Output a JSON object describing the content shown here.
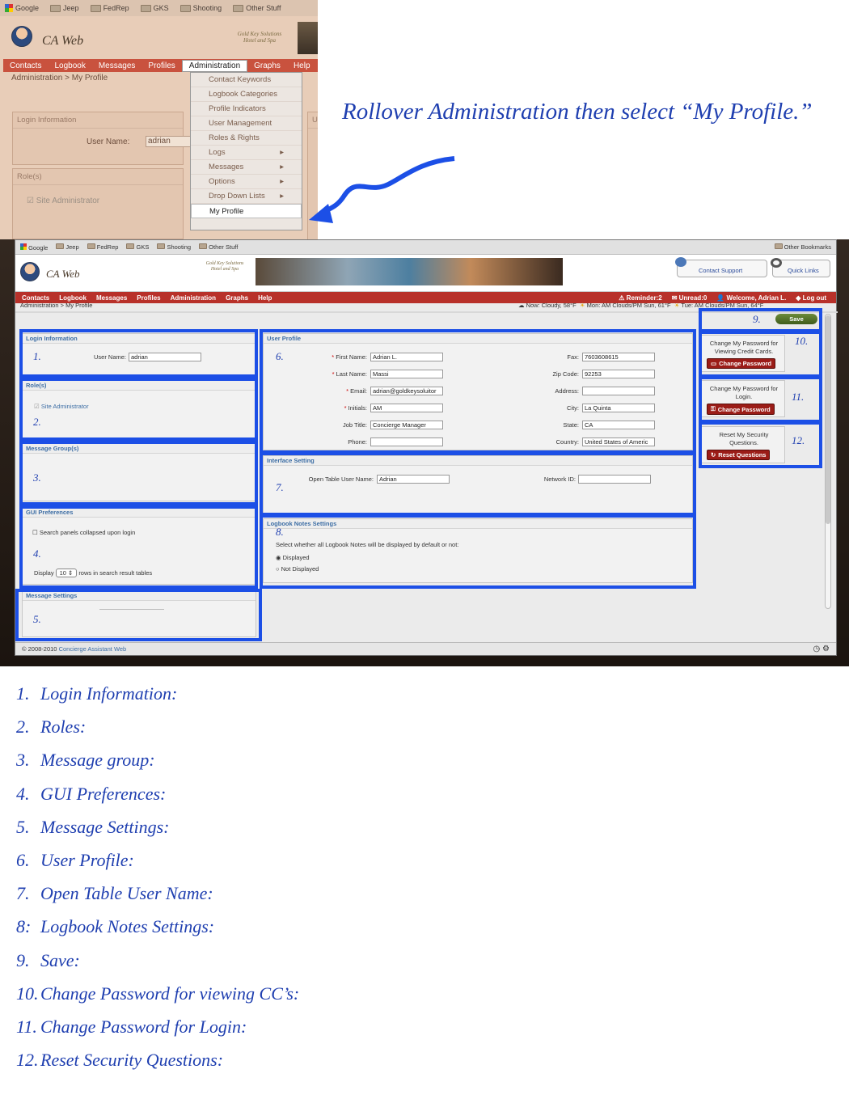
{
  "crop": {
    "bookmarks": [
      "Google",
      "Jeep",
      "FedRep",
      "GKS",
      "Shooting",
      "Other Stuff"
    ],
    "app_name": "CA Web",
    "hotel_logo": "Gold Key Solutions Hotel and Spa",
    "nav": [
      "Contacts",
      "Logbook",
      "Messages",
      "Profiles",
      "Administration",
      "Graphs",
      "Help"
    ],
    "breadcrumb": "Administration > My Profile",
    "menu": [
      "Contact Keywords",
      "Logbook Categories",
      "Profile Indicators",
      "User Management",
      "Roles & Rights",
      "Logs",
      "Messages",
      "Options",
      "Drop Down Lists",
      "My Profile"
    ],
    "menu_sub_arrows": [
      false,
      false,
      false,
      false,
      false,
      true,
      true,
      true,
      true,
      false
    ],
    "login_panel_title": "Login Information",
    "user_name_label": "User Name:",
    "user_name_value": "adrian",
    "roles_panel_title": "Role(s)",
    "role_value": "Site Administrator",
    "u_fragment": "U"
  },
  "instruction": "Rollover Administration then select “My Profile.”",
  "shot": {
    "bookmarks": [
      "Google",
      "Jeep",
      "FedRep",
      "GKS",
      "Shooting",
      "Other Stuff"
    ],
    "other_bookmarks": "Other Bookmarks",
    "app_name": "CA Web",
    "hotel_logo": "Gold Key Solutions Hotel and Spa",
    "contact_support": "Contact Support",
    "quick_links": "Quick Links",
    "nav": [
      "Contacts",
      "Logbook",
      "Messages",
      "Profiles",
      "Administration",
      "Graphs",
      "Help"
    ],
    "reminder": "Reminder:2",
    "unread": "Unread:0",
    "welcome": "Welcome, Adrian L.",
    "logout": "Log out",
    "breadcrumb": "Administration > My Profile",
    "weather_now": "Now: Cloudy, 58°F",
    "weather_mon": "Mon: AM Clouds/PM Sun, 61°F",
    "weather_tue": "Tue: AM Clouds/PM Sun, 64°F",
    "save": "Save",
    "login_info": {
      "title": "Login Information",
      "user_label": "User Name:",
      "user_value": "adrian"
    },
    "roles": {
      "title": "Role(s)",
      "value": "Site Administrator"
    },
    "message_groups": {
      "title": "Message Group(s)"
    },
    "gui_prefs": {
      "title": "GUI Preferences",
      "collapse_label": "Search panels collapsed upon login",
      "display_label": "Display",
      "rows_value": "10",
      "rows_suffix": "rows in search result tables"
    },
    "message_settings": {
      "title": "Message Settings"
    },
    "user_profile": {
      "title": "User Profile",
      "left": [
        {
          "label": "First Name:",
          "value": "Adrian L.",
          "req": true
        },
        {
          "label": "Last Name:",
          "value": "Massi",
          "req": true
        },
        {
          "label": "Email:",
          "value": "adrian@goldkeysoluitor",
          "req": true
        },
        {
          "label": "Initials:",
          "value": "AM",
          "req": true
        },
        {
          "label": "Job Title:",
          "value": "Concierge Manager",
          "req": false
        },
        {
          "label": "Phone:",
          "value": "",
          "req": false
        }
      ],
      "right": [
        {
          "label": "Fax:",
          "value": "7603608615"
        },
        {
          "label": "Zip Code:",
          "value": "92253"
        },
        {
          "label": "Address:",
          "value": ""
        },
        {
          "label": "City:",
          "value": "La Quinta"
        },
        {
          "label": "State:",
          "value": "CA"
        },
        {
          "label": "Country:",
          "value": "United States of Americ"
        }
      ]
    },
    "interface": {
      "title": "Interface Setting",
      "open_table_label": "Open Table User Name:",
      "open_table_value": "Adrian",
      "network_label": "Network ID:",
      "network_value": ""
    },
    "logbook_notes": {
      "title": "Logbook Notes Settings",
      "desc": "Select whether all Logbook Notes will be displayed by default or not:",
      "opt1": "Displayed",
      "opt2": "Not Displayed"
    },
    "cc_password": {
      "text": "Change My Password for Viewing Credit Cards.",
      "button": "Change Password"
    },
    "login_password": {
      "text": "Change My Password for Login.",
      "button": "Change Password"
    },
    "security": {
      "text": "Reset My Security Questions.",
      "button": "Reset Questions"
    },
    "footer": "© 2008-2010",
    "footer_link": "Concierge Assistant Web",
    "numbers": [
      "1.",
      "2.",
      "3.",
      "4.",
      "5.",
      "6.",
      "7.",
      "8.",
      "9.",
      "10.",
      "11.",
      "12."
    ]
  },
  "legend": [
    {
      "n": "1.",
      "t": "Login Information:"
    },
    {
      "n": "2.",
      "t": "Roles:"
    },
    {
      "n": "3.",
      "t": "Message group:"
    },
    {
      "n": "4.",
      "t": "GUI Preferences:"
    },
    {
      "n": "5.",
      "t": "Message Settings:"
    },
    {
      "n": "6.",
      "t": "User Profile:"
    },
    {
      "n": "7.",
      "t": "Open Table User Name:"
    },
    {
      "n": "8:",
      "t": "Logbook Notes Settings:"
    },
    {
      "n": "9.",
      "t": "Save:"
    },
    {
      "n": "10.",
      "t": "Change Password for viewing CC’s:"
    },
    {
      "n": "11.",
      "t": "Change Password for Login:"
    },
    {
      "n": "12.",
      "t": "Reset Security Questions:"
    }
  ],
  "colors": {
    "annotation_blue": "#1c4fe6",
    "nav_red": "#b8312a",
    "text_blue": "#1f3fb0"
  }
}
